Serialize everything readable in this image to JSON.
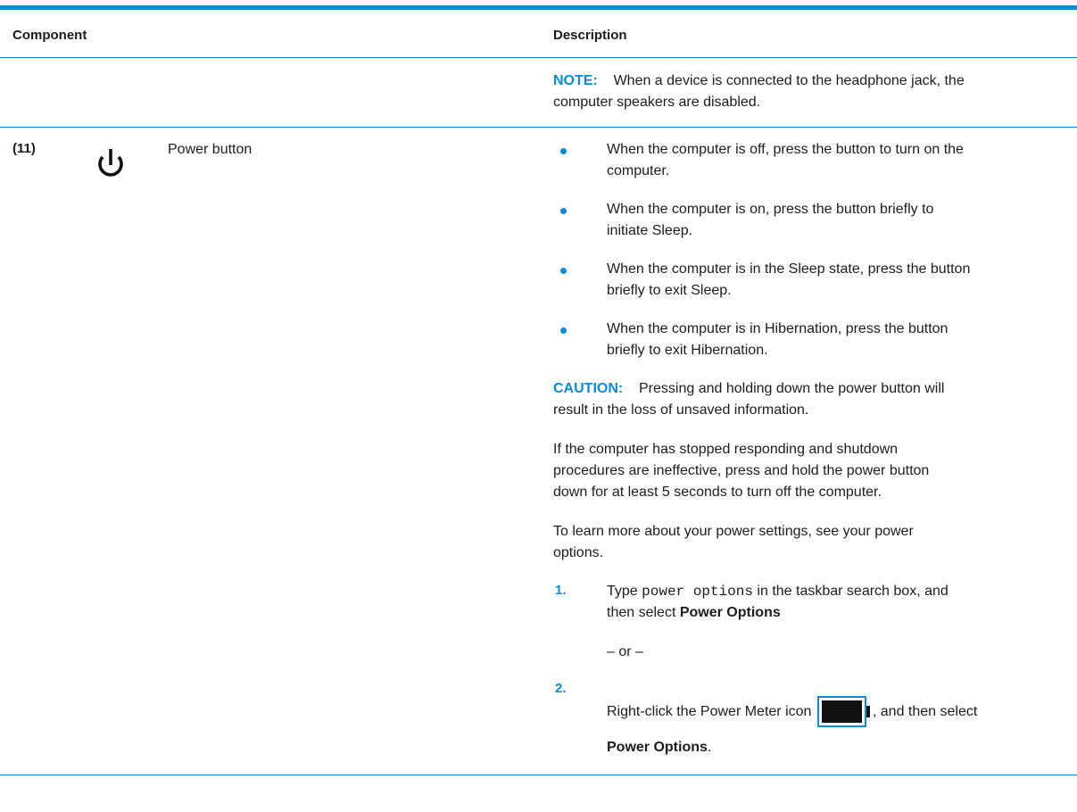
{
  "table": {
    "headers": {
      "component": "Component",
      "description": "Description"
    },
    "note": {
      "label": "NOTE:",
      "text_line1": "When a device is connected to the headphone jack, the",
      "text_line2": "computer speakers are disabled."
    },
    "row": {
      "number": "(11)",
      "icon": "power-icon",
      "component_name": "Power button",
      "bullets": [
        {
          "line1": "When the computer is off, press the button to turn on the",
          "line2": "computer."
        },
        {
          "line1": "When the computer is on, press the button briefly to",
          "line2": "initiate Sleep."
        },
        {
          "line1": "When the computer is in the Sleep state, press the button",
          "line2": "briefly to exit Sleep."
        },
        {
          "line1": "When the computer is in Hibernation, press the button",
          "line2": "briefly to exit Hibernation."
        }
      ],
      "caution": {
        "label": "CAUTION:",
        "text_line1": "Pressing and holding down the power button will",
        "text_line2": "result in the loss of unsaved information."
      },
      "para1": {
        "line1": "If the computer has stopped responding and shutdown",
        "line2": "procedures are ineffective, press and hold the power button",
        "line3": "down for at least 5 seconds to turn off the computer."
      },
      "para2": {
        "line1": "To learn more about your power settings, see your power",
        "line2": "options."
      },
      "steps": [
        {
          "number": "1.",
          "type_word": "Type",
          "code": "power options",
          "rest_line1": "in the taskbar search box, and",
          "line2_prefix": "then select",
          "line2_bold": "Power Options"
        },
        {
          "number": "2.",
          "prefix": "Right-click the Power Meter icon",
          "suffix": ", and then select",
          "bold_line": "Power Options",
          "bold_suffix": "."
        }
      ],
      "or_text": "– or –"
    }
  },
  "colors": {
    "accent": "#0b8ad6"
  }
}
